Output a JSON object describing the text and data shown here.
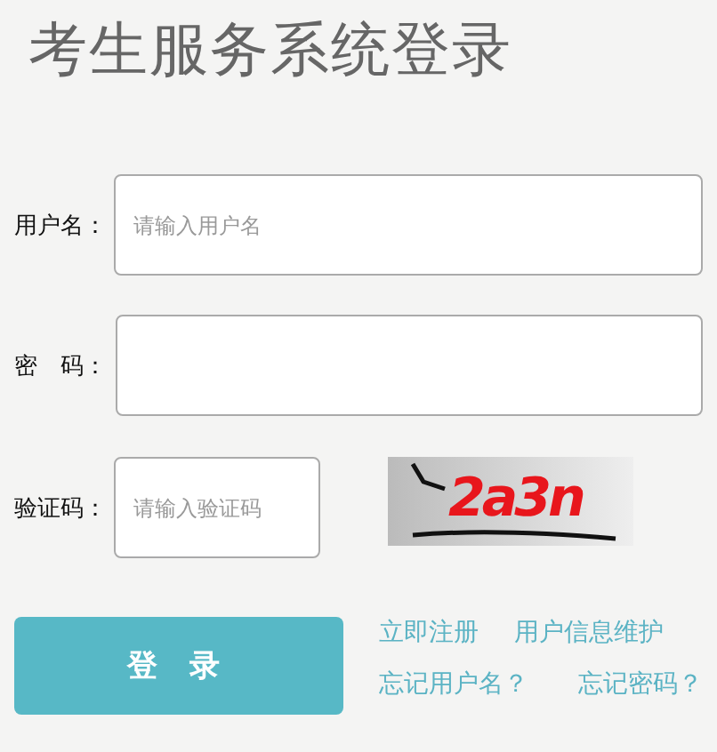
{
  "title": "考生服务系统登录",
  "fields": [
    {
      "label": "用户名：",
      "placeholder": "请输入用户名",
      "kind": "text"
    },
    {
      "label": "密　码：",
      "kind": "password"
    },
    {
      "label": "验证码：",
      "placeholder": "请输入验证码",
      "kind": "captcha"
    }
  ],
  "captcha": "2a3n",
  "login_button": "登 录",
  "links": [
    [
      "立即注册",
      "用户信息维护"
    ],
    [
      "忘记用户名？",
      "忘记密码？"
    ]
  ]
}
